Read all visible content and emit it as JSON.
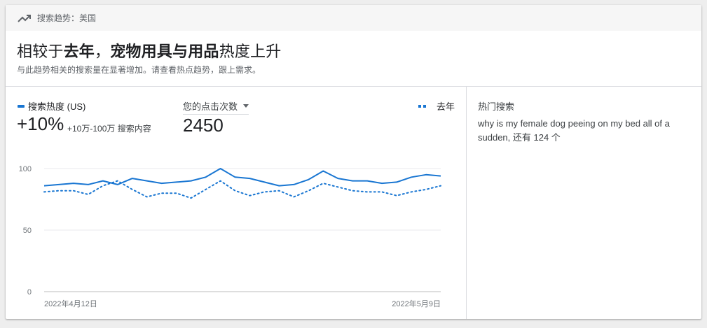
{
  "topbar": {
    "label": "搜索趋势：美国",
    "icon": "trending-up-icon"
  },
  "headline": {
    "part1": "相较于",
    "bold1": "去年",
    "part2": "，",
    "bold2": "宠物用具与用品",
    "part3": "热度上升"
  },
  "subline": "与此趋势相关的搜索量在显著增加。请查看热点趋势，跟上需求。",
  "legend": {
    "main_label": "搜索热度 (US)",
    "last_year_label": "去年",
    "main_color": "#1976d2"
  },
  "metric": {
    "change": "+10%",
    "range": "+10万-100万 搜索内容"
  },
  "clicks": {
    "dropdown_label": "您的点击次数",
    "value": "2450"
  },
  "chart_data": {
    "type": "line",
    "x_start_label": "2022年4月12日",
    "x_end_label": "2022年5月9日",
    "ylim": [
      0,
      100
    ],
    "yticks": [
      "0",
      "50",
      "100"
    ],
    "grid": true,
    "series": [
      {
        "name": "搜索热度 (US)",
        "style": "solid",
        "color": "#1976d2",
        "values": [
          86,
          87,
          88,
          87,
          90,
          87,
          92,
          90,
          88,
          89,
          90,
          93,
          100,
          93,
          92,
          89,
          86,
          87,
          91,
          98,
          92,
          90,
          90,
          88,
          89,
          93,
          95,
          94
        ]
      },
      {
        "name": "去年",
        "style": "dotted",
        "color": "#1976d2",
        "values": [
          81,
          82,
          82,
          79,
          86,
          90,
          83,
          77,
          80,
          80,
          76,
          83,
          90,
          82,
          78,
          81,
          82,
          77,
          82,
          88,
          85,
          82,
          81,
          81,
          78,
          81,
          83,
          86
        ]
      }
    ]
  },
  "right_panel": {
    "title": "热门搜索",
    "query": "why is my female dog peeing on my bed all of a sudden",
    "more": ", 还有 124 个"
  }
}
